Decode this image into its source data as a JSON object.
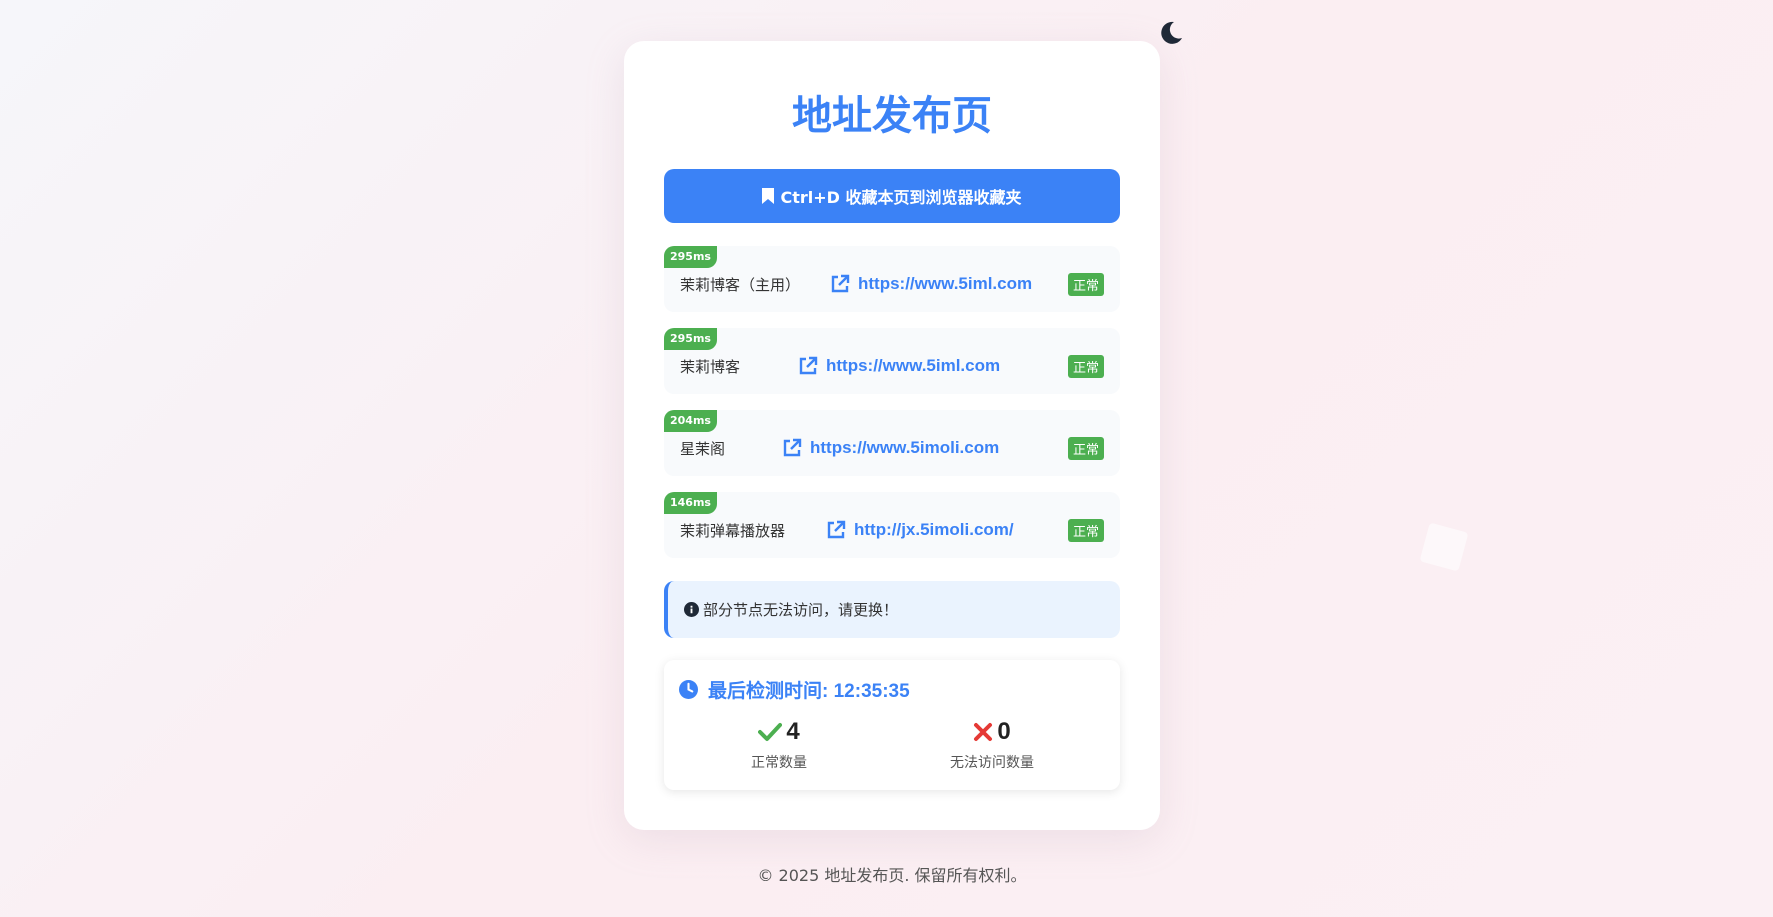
{
  "page": {
    "title": "地址发布页",
    "bookmark_label": "Ctrl+D 收藏本页到浏览器收藏夹",
    "footer": "© 2025 地址发布页. 保留所有权利。"
  },
  "links": [
    {
      "latency": "295ms",
      "name": "茉莉博客（主用）",
      "url": "https://www.5iml.com",
      "status": "正常"
    },
    {
      "latency": "295ms",
      "name": "茉莉博客",
      "url": "https://www.5iml.com",
      "status": "正常"
    },
    {
      "latency": "204ms",
      "name": "星茉阁",
      "url": "https://www.5imoli.com",
      "status": "正常"
    },
    {
      "latency": "146ms",
      "name": "茉莉弹幕播放器",
      "url": "http://jx.5imoli.com/",
      "status": "正常"
    }
  ],
  "notice": {
    "text": "部分节点无法访问，请更换！"
  },
  "stats": {
    "last_check": "最后检测时间: 12:35:35",
    "ok_count": "4",
    "ok_label": "正常数量",
    "fail_count": "0",
    "fail_label": "无法访问数量"
  },
  "colors": {
    "accent": "#3b82f6",
    "ok": "#4caf50",
    "fail": "#e53935"
  },
  "icons": {
    "theme": "moon-icon",
    "bookmark": "bookmark-icon",
    "external": "external-link-icon",
    "info": "info-icon",
    "clock": "clock-icon",
    "check": "check-icon",
    "cross": "cross-icon"
  }
}
